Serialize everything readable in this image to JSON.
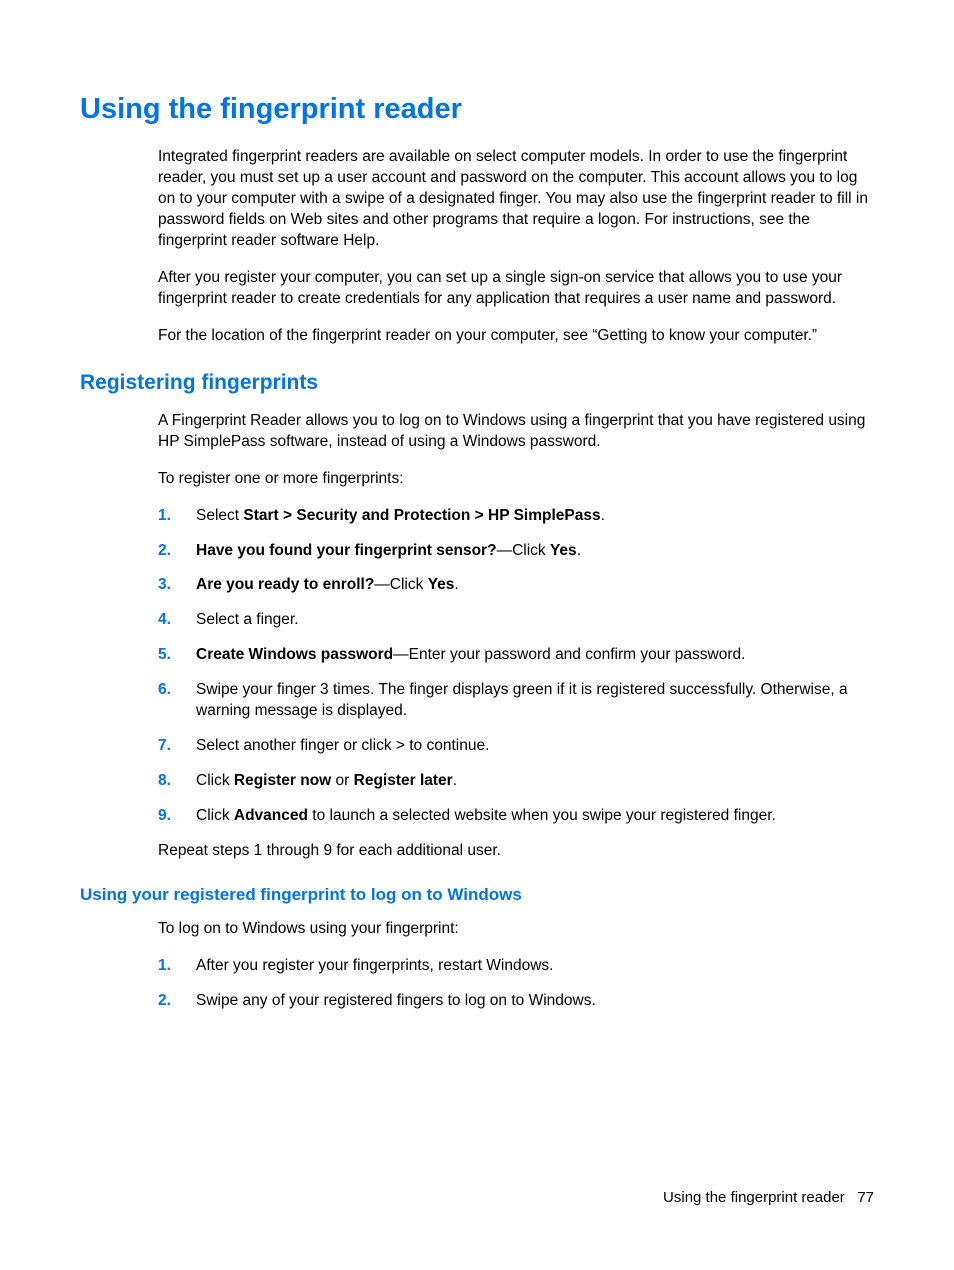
{
  "h1": "Using the fingerprint reader",
  "intro_p1": "Integrated fingerprint readers are available on select computer models. In order to use the fingerprint reader, you must set up a user account and password on the computer. This account allows you to log on to your computer with a swipe of a designated finger. You may also use the fingerprint reader to fill in password fields on Web sites and other programs that require a logon. For instructions, see the fingerprint reader software Help.",
  "intro_p2": "After you register your computer, you can set up a single sign-on service that allows you to use your fingerprint reader to create credentials for any application that requires a user name and password.",
  "intro_p3": "For the location of the fingerprint reader on your computer, see “Getting to know your computer.”",
  "h2": "Registering fingerprints",
  "reg_p1": "A Fingerprint Reader allows you to log on to Windows using a fingerprint that you have registered using HP SimplePass software, instead of using a Windows password.",
  "reg_p2": "To register one or more fingerprints:",
  "step1_a": "Select ",
  "step1_b": "Start > Security and Protection > HP SimplePass",
  "step1_c": ".",
  "step2_a": "Have you found your fingerprint sensor?",
  "step2_b": "—Click ",
  "step2_c": "Yes",
  "step2_d": ".",
  "step3_a": "Are you ready to enroll?",
  "step3_b": "—Click ",
  "step3_c": "Yes",
  "step3_d": ".",
  "step4": "Select a finger.",
  "step5_a": "Create Windows password",
  "step5_b": "—Enter your password and confirm your password.",
  "step6": "Swipe your finger 3 times. The finger displays green if it is registered successfully. Otherwise, a warning message is displayed.",
  "step7": "Select another finger or click > to continue.",
  "step8_a": "Click ",
  "step8_b": "Register now",
  "step8_c": " or ",
  "step8_d": "Register later",
  "step8_e": ".",
  "step9_a": "Click ",
  "step9_b": "Advanced",
  "step9_c": " to launch a selected website when you swipe your registered finger.",
  "reg_p3": "Repeat steps 1 through 9 for each additional user.",
  "h3": "Using your registered fingerprint to log on to Windows",
  "logon_p1": "To log on to Windows using your fingerprint:",
  "logon_step1": "After you register your fingerprints, restart Windows.",
  "logon_step2": "Swipe any of your registered fingers to log on to Windows.",
  "footer_text": "Using the fingerprint reader",
  "page_num": "77",
  "n1": "1.",
  "n2": "2.",
  "n3": "3.",
  "n4": "4.",
  "n5": "5.",
  "n6": "6.",
  "n7": "7.",
  "n8": "8.",
  "n9": "9."
}
